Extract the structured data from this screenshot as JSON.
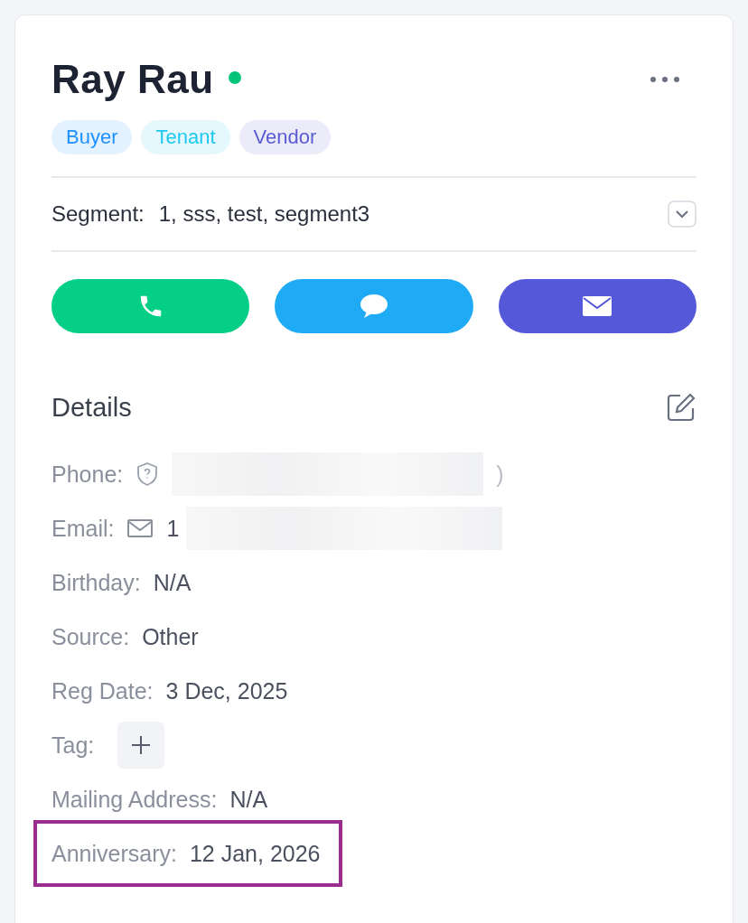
{
  "contact": {
    "name": "Ray Rau",
    "online": true
  },
  "roles": [
    {
      "label": "Buyer",
      "color": "#1e90ff"
    },
    {
      "label": "Tenant",
      "color": "#1ec8f0"
    },
    {
      "label": "Vendor",
      "color": "#5b5bd6"
    }
  ],
  "segment": {
    "label": "Segment:",
    "value": "1, sss, test, segment3"
  },
  "actions": [
    {
      "kind": "call",
      "color": "#05cf86"
    },
    {
      "kind": "message",
      "color": "#1eaaf5"
    },
    {
      "kind": "email",
      "color": "#5558d9"
    }
  ],
  "details": {
    "title": "Details",
    "rows": [
      {
        "kind": "phone",
        "label": "Phone:",
        "value": ")",
        "redacted": true,
        "highlighted": false
      },
      {
        "kind": "email",
        "label": "Email:",
        "value": "1",
        "redacted": true,
        "highlighted": false
      },
      {
        "kind": "text",
        "label": "Birthday:",
        "value": "N/A",
        "highlighted": false
      },
      {
        "kind": "text",
        "label": "Source:",
        "value": "Other",
        "highlighted": false
      },
      {
        "kind": "text",
        "label": "Reg Date:",
        "value": "3 Dec, 2025",
        "highlighted": false
      },
      {
        "kind": "tag",
        "label": "Tag:",
        "highlighted": false
      },
      {
        "kind": "text",
        "label": "Mailing Address:",
        "value": "N/A",
        "highlighted": false
      },
      {
        "kind": "text",
        "label": "Anniversary:",
        "value": "12 Jan, 2026",
        "highlighted": true
      }
    ]
  }
}
